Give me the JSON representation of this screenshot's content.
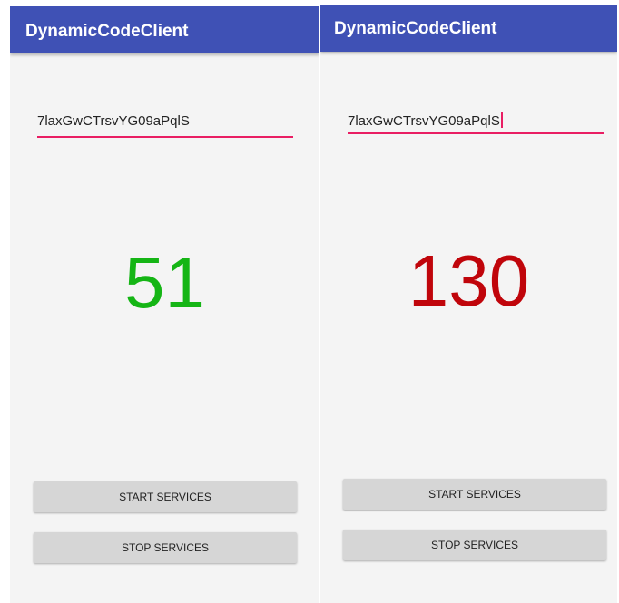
{
  "screens": [
    {
      "app_title": "DynamicCodeClient",
      "key_field": {
        "value": "7laxGwCTrsvYG09aPqlS"
      },
      "counter": {
        "value": "51",
        "color": "#15b515"
      },
      "start_button": "START SERVICES",
      "stop_button": "STOP SERVICES"
    },
    {
      "app_title": "DynamicCodeClient",
      "key_field": {
        "value": "7laxGwCTrsvYG09aPqlS"
      },
      "counter": {
        "value": "130",
        "color": "#c0050b"
      },
      "start_button": "START SERVICES",
      "stop_button": "STOP SERVICES"
    }
  ],
  "colors": {
    "app_bar": "#3f51b5",
    "accent": "#e91e63",
    "background": "#f4f4f4",
    "button": "#d6d6d6"
  }
}
